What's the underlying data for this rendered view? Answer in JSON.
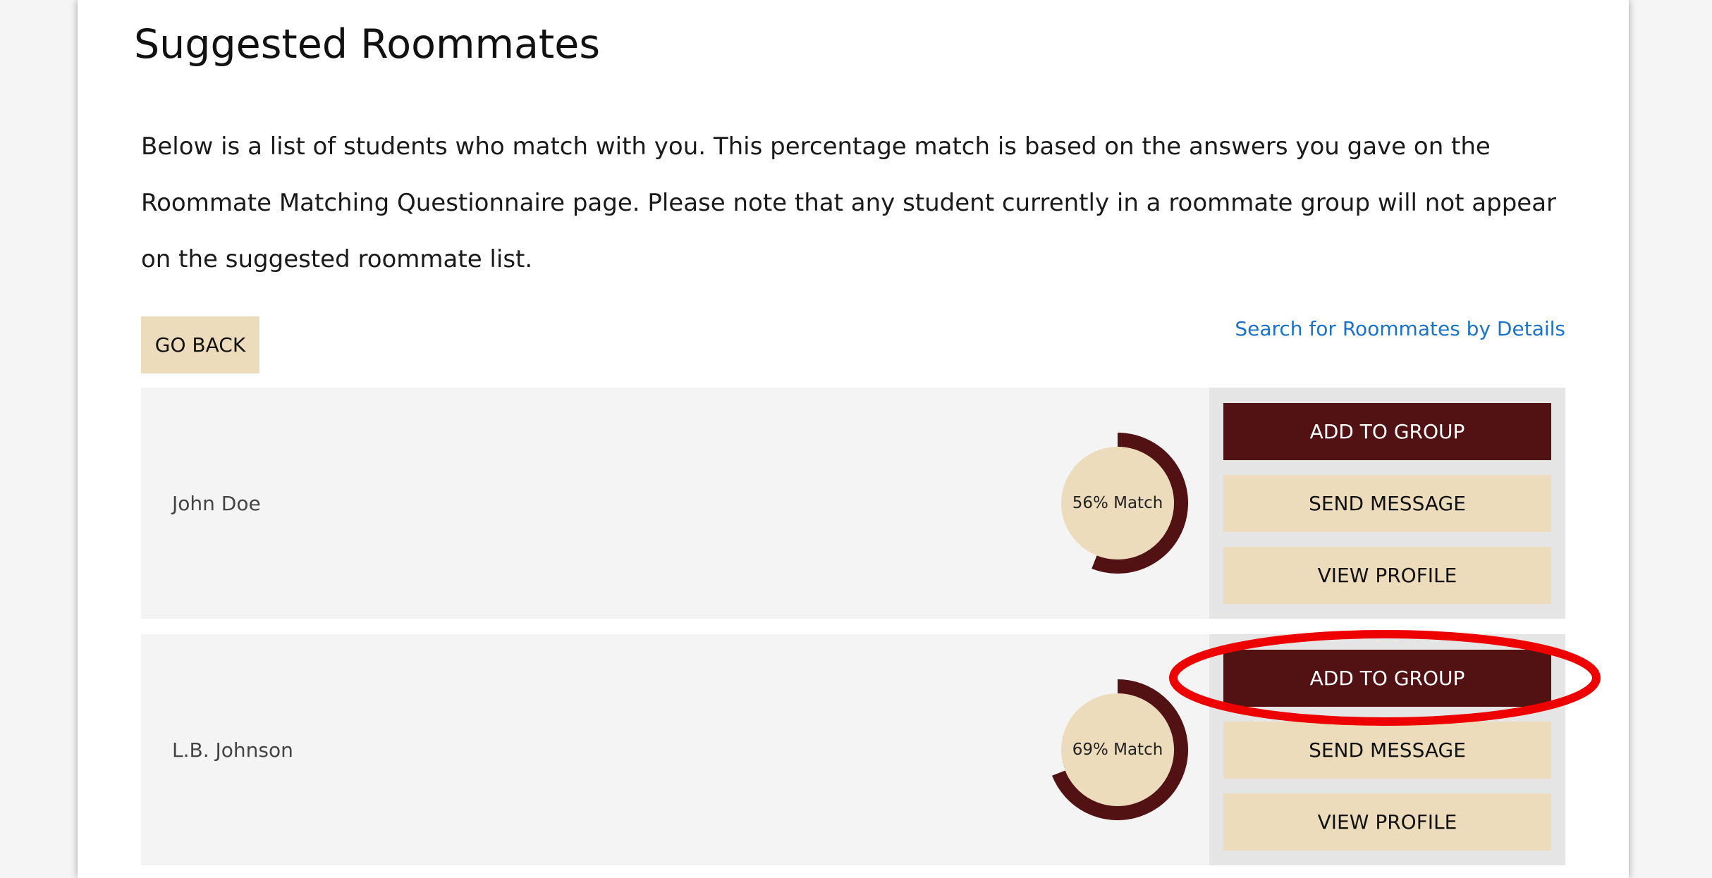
{
  "page": {
    "title": "Suggested Roommates",
    "intro": "Below is a list of students who match with you. This percentage match is based on the answers you gave on the Roommate Matching Questionnaire page. Please note that any student currently in a roommate group will not appear on the suggested roommate list.",
    "go_back_label": "GO BACK",
    "search_link_label": "Search for Roommates by Details"
  },
  "colors": {
    "brand_maroon": "#521214",
    "brand_tan": "#ecdcbb",
    "link_blue": "#1a73c8",
    "annotation_red": "#ee0000"
  },
  "roommates": [
    {
      "name": "John Doe",
      "match_percent": 56,
      "match_label": "56% Match",
      "add_label": "ADD TO GROUP",
      "message_label": "SEND MESSAGE",
      "profile_label": "VIEW PROFILE"
    },
    {
      "name": "L.B. Johnson",
      "match_percent": 69,
      "match_label": "69% Match",
      "add_label": "ADD TO GROUP",
      "message_label": "SEND MESSAGE",
      "profile_label": "VIEW PROFILE"
    }
  ],
  "annotation": {
    "shape": "ellipse",
    "target": "roommates.1.add_label"
  }
}
